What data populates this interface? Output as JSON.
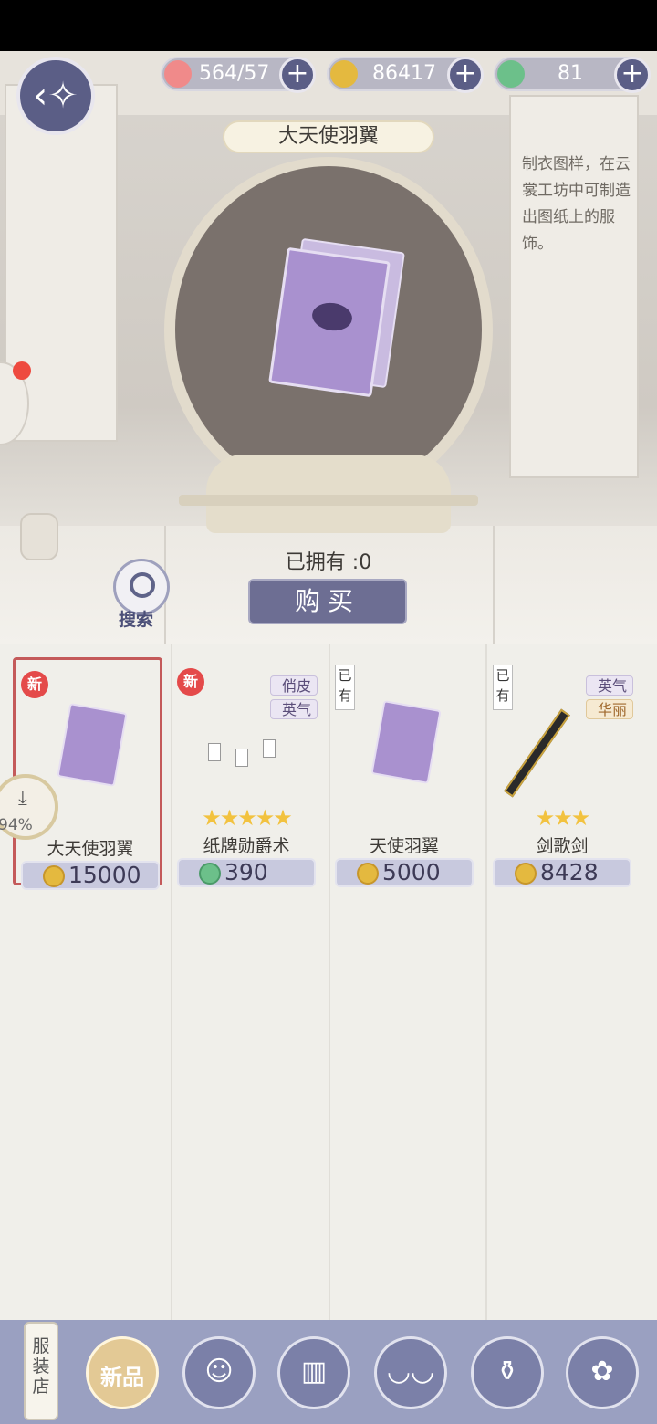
{
  "resources": {
    "stamina": "564/57",
    "coins": "86417",
    "gems": "81"
  },
  "item": {
    "title": "大天使羽翼",
    "description": "制衣图样，在云裳工坊中可制造出图纸上的服饰。",
    "owned_label": "已拥有 :0",
    "buy_label": "购买"
  },
  "search": {
    "label": "搜索"
  },
  "download": {
    "percent": "94%"
  },
  "products": [
    {
      "name": "大天使羽翼",
      "price": "15000",
      "currency": "coin",
      "badge": "新",
      "selected": true,
      "stars": "",
      "tags": []
    },
    {
      "name": "纸牌勋爵术",
      "price": "390",
      "currency": "gem",
      "badge": "新",
      "stars": "★★★★★",
      "tags": [
        "俏皮",
        "英气"
      ]
    },
    {
      "name": "天使羽翼",
      "price": "5000",
      "currency": "coin",
      "owned": "已有",
      "stars": "",
      "tags": []
    },
    {
      "name": "剑歌剑",
      "price": "8428",
      "currency": "coin",
      "owned": "已有",
      "stars": "★★★",
      "tags": [
        "英气",
        "华丽"
      ]
    }
  ],
  "nav": {
    "shop_label": "服装店",
    "active_label": "新品",
    "icons": [
      "hair-icon",
      "top-icon",
      "shoes-icon",
      "perfume-icon",
      "accessory-icon"
    ]
  },
  "colors": {
    "accent": "#5b5e86",
    "selected_border": "#c45a5a",
    "coin": "#e4b93f"
  }
}
